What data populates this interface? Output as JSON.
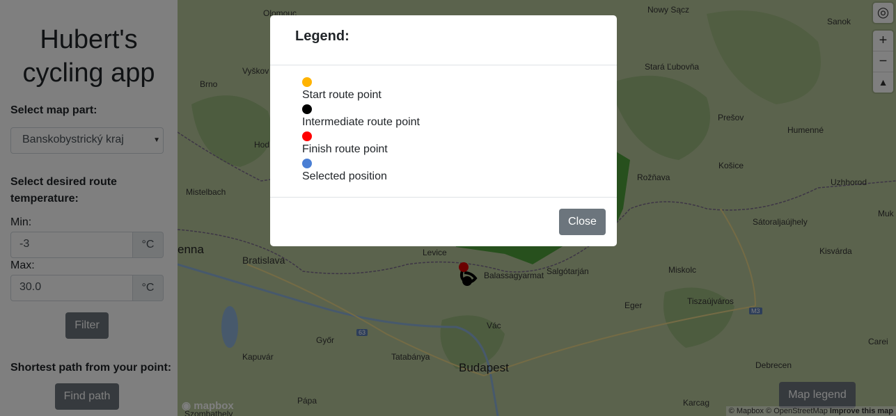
{
  "sidebar": {
    "title": "Hubert's cycling app",
    "map_part_label": "Select map part:",
    "map_part_selected": "Banskobystrický kraj",
    "temp_label": "Select desired route temperature:",
    "min_label": "Min:",
    "min_value": "-3",
    "max_label": "Max:",
    "max_value": "30.0",
    "unit": "°C",
    "filter_button": "Filter",
    "shortest_label": "Shortest path from your point:",
    "find_path_button": "Find path"
  },
  "map": {
    "cities": [
      {
        "name": "Olomouc",
        "big": false
      },
      {
        "name": "Nowy Sącz",
        "big": false
      },
      {
        "name": "Sanok",
        "big": false
      },
      {
        "name": "Vyškov",
        "big": false
      },
      {
        "name": "Brno",
        "big": false
      },
      {
        "name": "Stará Ľubovňa",
        "big": false
      },
      {
        "name": "Prešov",
        "big": false
      },
      {
        "name": "Humenné",
        "big": false
      },
      {
        "name": "Košice",
        "big": false
      },
      {
        "name": "Rožňava",
        "big": false
      },
      {
        "name": "Uzhhorod",
        "big": false
      },
      {
        "name": "Sátoraljaújhely",
        "big": false
      },
      {
        "name": "Muk",
        "big": false
      },
      {
        "name": "Mistelbach",
        "big": false
      },
      {
        "name": "Hod",
        "big": false
      },
      {
        "name": "enna",
        "big": true
      },
      {
        "name": "Bratislava",
        "big": false
      },
      {
        "name": "Levice",
        "big": false
      },
      {
        "name": "Balassagyarmat",
        "big": false
      },
      {
        "name": "Salgótarján",
        "big": false
      },
      {
        "name": "Miskolc",
        "big": false
      },
      {
        "name": "Kisvárda",
        "big": false
      },
      {
        "name": "Eger",
        "big": false
      },
      {
        "name": "Tiszaújváros",
        "big": false
      },
      {
        "name": "Vác",
        "big": false
      },
      {
        "name": "Győr",
        "big": false
      },
      {
        "name": "Kapuvár",
        "big": false
      },
      {
        "name": "Tatabánya",
        "big": false
      },
      {
        "name": "Budapest",
        "big": true
      },
      {
        "name": "Pápa",
        "big": false
      },
      {
        "name": "Debrecen",
        "big": false
      },
      {
        "name": "Carei",
        "big": false
      },
      {
        "name": "Karcag",
        "big": false
      },
      {
        "name": "Szombathely",
        "big": false
      }
    ],
    "road_labels": [
      "63",
      "M3"
    ],
    "zoom_in": "+",
    "zoom_out": "−",
    "legend_button": "Map legend",
    "logo": "mapbox",
    "attribution": {
      "a": "© Mapbox",
      "b": "© OpenStreetMap",
      "c": "Improve this map"
    }
  },
  "modal": {
    "title": "Legend:",
    "items": [
      {
        "label": "Start route point",
        "color": "#ffb300"
      },
      {
        "label": "Intermediate route point",
        "color": "#000000"
      },
      {
        "label": "Finish route point",
        "color": "#ff0000"
      },
      {
        "label": "Selected position",
        "color": "#4a7fd4"
      }
    ],
    "close_button": "Close"
  },
  "colors": {
    "button": "#6c757d",
    "region": "#3c9a2a",
    "overlay": "rgba(0,0,0,0.5)"
  }
}
